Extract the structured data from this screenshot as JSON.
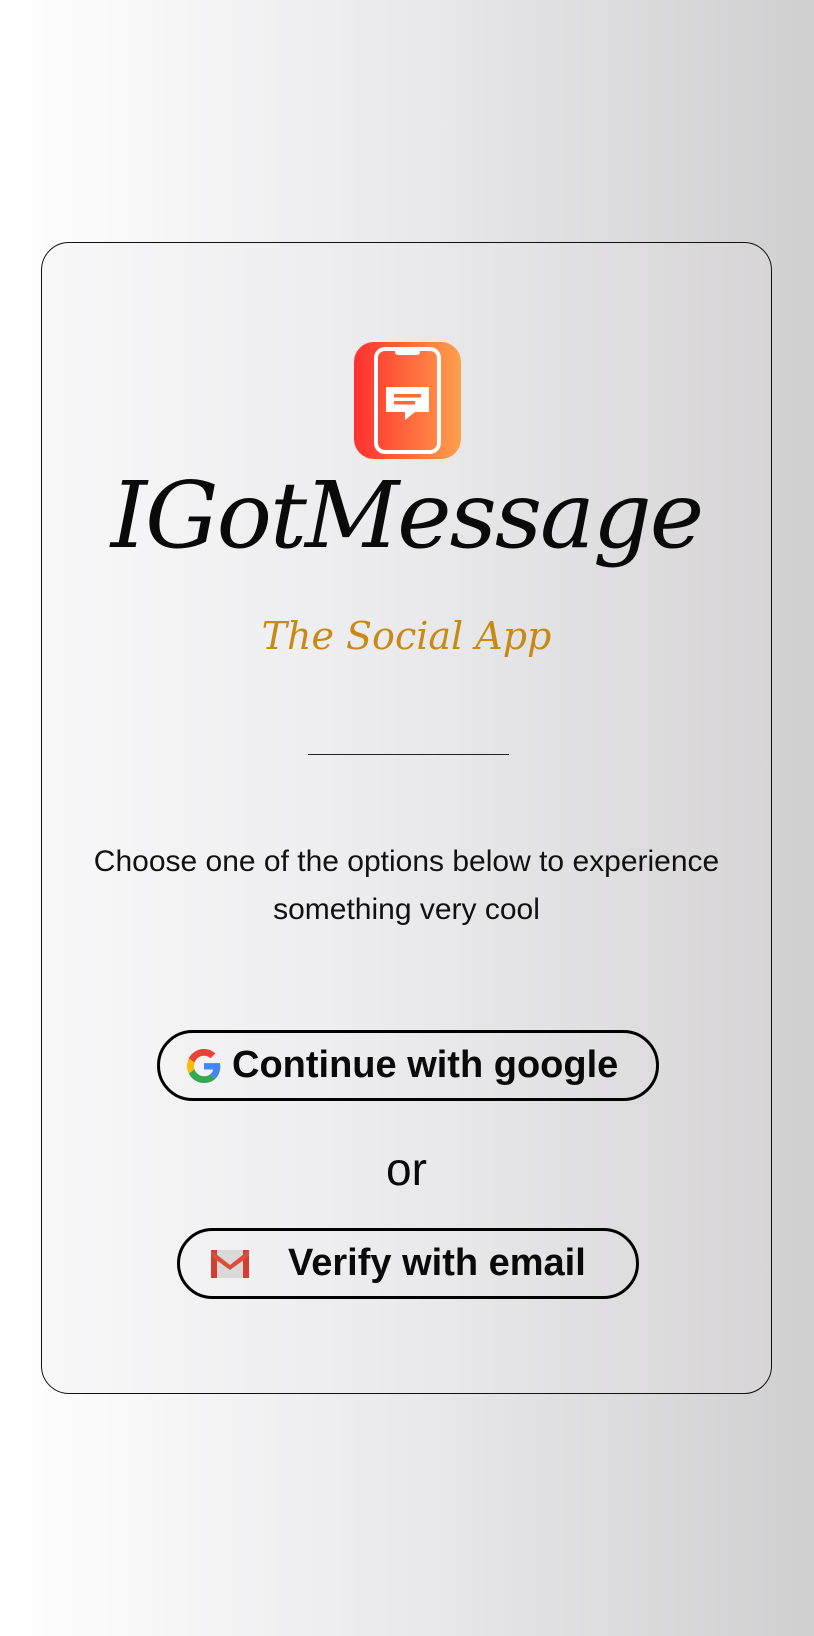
{
  "app": {
    "title": "IGotMessage",
    "subtitle": "The Social App"
  },
  "intro": {
    "text": "Choose one of the options below to experience something very cool"
  },
  "buttons": {
    "google_label": "Continue with google",
    "or_text": "or",
    "email_label": "Verify with email"
  },
  "icons": {
    "logo": "phone-chat-icon",
    "google": "google-icon",
    "email": "gmail-icon"
  },
  "colors": {
    "logo_gradient_start": "#ff3030",
    "logo_gradient_end": "#ff9e4a",
    "subtitle": "#c78a17",
    "border": "#000000"
  }
}
